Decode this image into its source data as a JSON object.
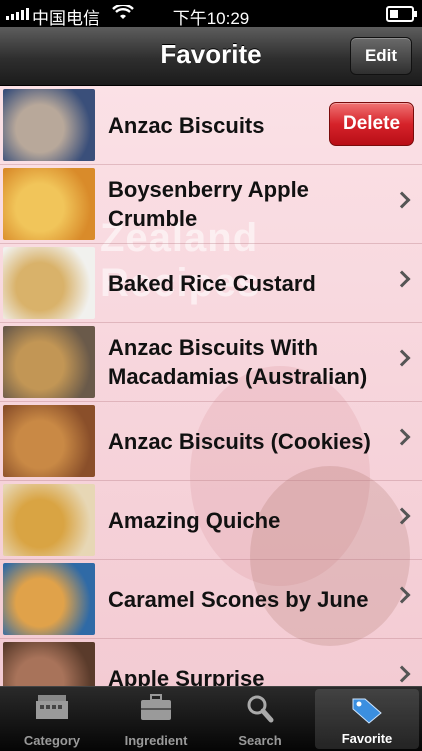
{
  "status_bar": {
    "carrier": "中国电信",
    "time": "下午10:29"
  },
  "nav": {
    "title": "Favorite",
    "edit_label": "Edit"
  },
  "background_watermark": "Zealand Recipes",
  "list": {
    "delete_label": "Delete",
    "items": [
      {
        "title": "Anzac Biscuits",
        "thumb_colors": [
          "#3a4f7a",
          "#b8a89a"
        ]
      },
      {
        "title": "Boysenberry Apple Crumble",
        "thumb_colors": [
          "#d98b2a",
          "#f1c55a"
        ]
      },
      {
        "title": "Baked Rice Custard",
        "thumb_colors": [
          "#f1f1ee",
          "#d9b26a"
        ]
      },
      {
        "title": "Anzac Biscuits With Macadamias (Australian)",
        "thumb_colors": [
          "#6a5a4a",
          "#c29655"
        ]
      },
      {
        "title": "Anzac Biscuits (Cookies)",
        "thumb_colors": [
          "#8a4f2a",
          "#c98945"
        ]
      },
      {
        "title": "Amazing Quiche",
        "thumb_colors": [
          "#e7d7b5",
          "#d9a443"
        ]
      },
      {
        "title": "Caramel Scones by June",
        "thumb_colors": [
          "#2f6aa6",
          "#e0a24a"
        ]
      },
      {
        "title": "Apple Surprise",
        "thumb_colors": [
          "#5a3b2b",
          "#a8735a"
        ]
      }
    ]
  },
  "tabs": [
    {
      "label": "Category",
      "icon": "category-icon",
      "active": false
    },
    {
      "label": "Ingredient",
      "icon": "briefcase-icon",
      "active": false
    },
    {
      "label": "Search",
      "icon": "search-icon",
      "active": false
    },
    {
      "label": "Favorite",
      "icon": "tag-icon",
      "active": true
    }
  ]
}
